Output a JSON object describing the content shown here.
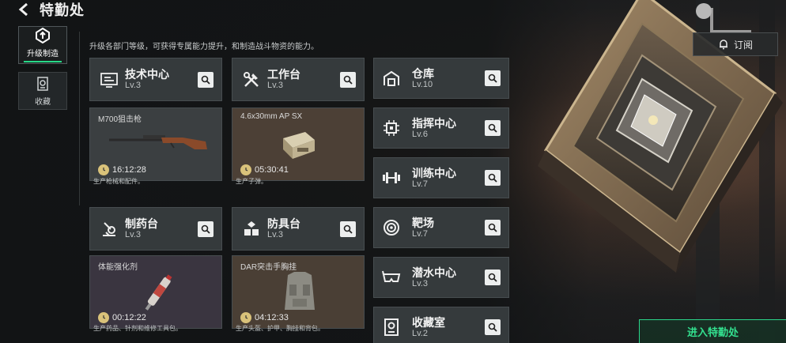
{
  "header": {
    "title": "特勤处"
  },
  "nav": [
    {
      "label": "升级制造",
      "active": true
    },
    {
      "label": "收藏",
      "active": false
    }
  ],
  "subtitle": "升级各部门等级，可获得专属能力提升，和制造战斗物资的能力。",
  "subscribe_label": "订阅",
  "main_cards": [
    {
      "name": "技术中心",
      "level": "Lv.3",
      "icon": "tech-center-icon",
      "item": "M700狙击枪",
      "time": "16:12:28",
      "desc": "生产枪械和配件。",
      "box_color": "#3b3f41"
    },
    {
      "name": "工作台",
      "level": "Lv.3",
      "icon": "workbench-tools-icon",
      "item": "4.6x30mm AP SX",
      "time": "05:30:41",
      "desc": "生产子弹。",
      "box_color": "#4c4036"
    },
    {
      "name": "制药台",
      "level": "Lv.3",
      "icon": "pharmacy-icon",
      "item": "体能强化剂",
      "time": "00:12:22",
      "desc": "生产药品、针剂和维修工具包。",
      "box_color": "#3a3540"
    },
    {
      "name": "防具台",
      "level": "Lv.3",
      "icon": "armor-bench-icon",
      "item": "DAR突击手胸挂",
      "time": "04:12:33",
      "desc": "生产头盔、护甲、胸挂和背包。",
      "box_color": "#4a3f35"
    }
  ],
  "side_cards": [
    {
      "name": "仓库",
      "level": "Lv.10",
      "icon": "warehouse-icon"
    },
    {
      "name": "指挥中心",
      "level": "Lv.6",
      "icon": "command-center-icon"
    },
    {
      "name": "训练中心",
      "level": "Lv.7",
      "icon": "training-center-icon"
    },
    {
      "name": "靶场",
      "level": "Lv.7",
      "icon": "shooting-range-icon"
    },
    {
      "name": "潜水中心",
      "level": "Lv.3",
      "icon": "diving-center-icon"
    },
    {
      "name": "收藏室",
      "level": "Lv.2",
      "icon": "collection-room-icon"
    }
  ],
  "enter_label": "进入特勤处",
  "colors": {
    "accent": "#2bd58a",
    "panel": "#353a3c"
  }
}
